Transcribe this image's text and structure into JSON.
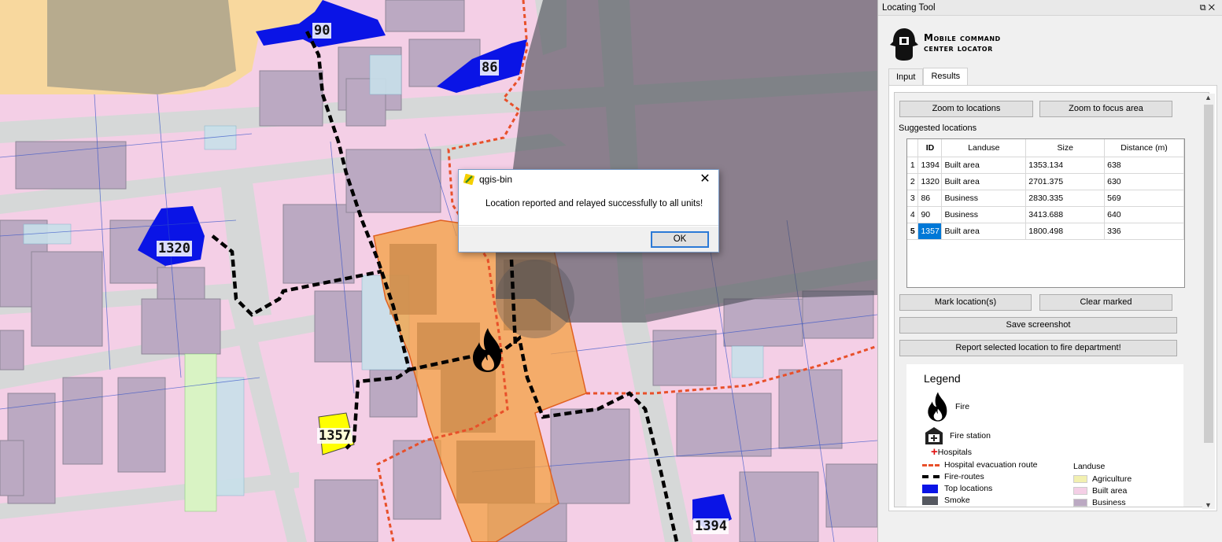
{
  "map": {
    "labels": {
      "l90": "90",
      "l86": "86",
      "l1320": "1320",
      "l1357": "1357",
      "l1394": "1394"
    }
  },
  "dialog": {
    "title": "qgis-bin",
    "message": "Location reported and relayed successfully to all units!",
    "ok": "OK",
    "close": "✕"
  },
  "panel": {
    "title": "Locating Tool",
    "logo_line1": "Mobile command",
    "logo_line2": "center locator",
    "tabs": [
      "Input",
      "Results"
    ],
    "active_tab": "Results",
    "zoom_locations": "Zoom to locations",
    "zoom_focus": "Zoom to focus area",
    "suggested": "Suggested locations",
    "mark": "Mark location(s)",
    "clear": "Clear marked",
    "save": "Save screenshot",
    "report": "Report selected location to fire department!"
  },
  "table": {
    "headers": [
      "ID",
      "Landuse",
      "Size",
      "Distance (m)"
    ],
    "rows": [
      {
        "n": "1",
        "id": "1394",
        "landuse": "Built area",
        "size": "1353.134",
        "dist": "638"
      },
      {
        "n": "2",
        "id": "1320",
        "landuse": "Built area",
        "size": "2701.375",
        "dist": "630"
      },
      {
        "n": "3",
        "id": "86",
        "landuse": "Business",
        "size": "2830.335",
        "dist": "569"
      },
      {
        "n": "4",
        "id": "90",
        "landuse": "Business",
        "size": "3413.688",
        "dist": "640"
      },
      {
        "n": "5",
        "id": "1357",
        "landuse": "Built area",
        "size": "1800.498",
        "dist": "336"
      }
    ],
    "selected_row": 5
  },
  "legend": {
    "title": "Legend",
    "fire": "Fire",
    "fire_station": "Fire station",
    "hospitals": "Hospitals",
    "evac": "Hospital evacuation route",
    "fire_routes": "Fire-routes",
    "top_locations": "Top locations",
    "smoke": "Smoke",
    "landuse_title": "Landuse",
    "agriculture": "Agriculture",
    "built_area": "Built area",
    "business": "Business"
  },
  "colors": {
    "top_locations": "#0a14e6",
    "selected": "#ffff00",
    "fire_route": "#000000",
    "evac_route": "#e8502a",
    "smoke": "#555860",
    "focus_area": "#f4a040"
  }
}
